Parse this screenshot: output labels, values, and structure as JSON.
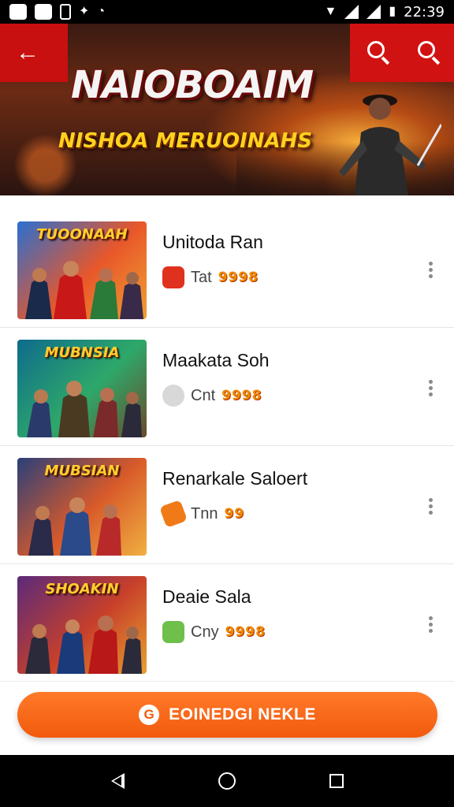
{
  "status_bar": {
    "time": "22:39",
    "icons": [
      "message-icon",
      "app-icon",
      "photo-icon",
      "notification-icon",
      "cast-icon",
      "wifi-icon",
      "signal-icon",
      "signal-icon",
      "battery-icon"
    ]
  },
  "banner": {
    "title": "NAIOBOAIM",
    "subtitle": "NISHOA MERUOINAHS",
    "back_icon": "back-arrow-icon",
    "actions": [
      "search-icon",
      "search-icon"
    ]
  },
  "list": {
    "items": [
      {
        "thumb_title": "TUOONAAH",
        "title": "Unitoda Ran",
        "meta_label": "Tat",
        "rating": "9998",
        "meta_icon": "gift-icon",
        "icon_color": "#e0301e",
        "thumb_bg": [
          "#2a6fd1",
          "#e8572a",
          "#f0a030"
        ]
      },
      {
        "thumb_title": "MUBNSIA",
        "title": "Maakata Soh",
        "meta_label": "Cnt",
        "rating": "9998",
        "meta_icon": "coin-icon",
        "icon_color": "#d8d8d8",
        "thumb_bg": [
          "#0e6b8c",
          "#2ea86a",
          "#6a4a2a"
        ]
      },
      {
        "thumb_title": "MUBSIAN",
        "title": "Renarkale Saloert",
        "meta_label": "Tnn",
        "rating": "99",
        "meta_icon": "ticket-icon",
        "icon_color": "#f07a18",
        "thumb_bg": [
          "#2a3f7a",
          "#d85a2a",
          "#f0b040"
        ]
      },
      {
        "thumb_title": "SHOAKIN",
        "title": "Deaie Sala",
        "meta_label": "Cny",
        "rating": "9998",
        "meta_icon": "badge-icon",
        "icon_color": "#6ec04a",
        "thumb_bg": [
          "#5a2a7a",
          "#c8402a",
          "#e8a030"
        ]
      }
    ]
  },
  "cta": {
    "label": "EOINEDGI NEKLE",
    "icon_glyph": "G"
  },
  "nav_bar": {
    "buttons": [
      "back-icon",
      "home-icon",
      "recents-icon"
    ]
  },
  "colors": {
    "accent": "#f25a0c",
    "banner_red": "#c81010",
    "rating": "#f08a00"
  }
}
